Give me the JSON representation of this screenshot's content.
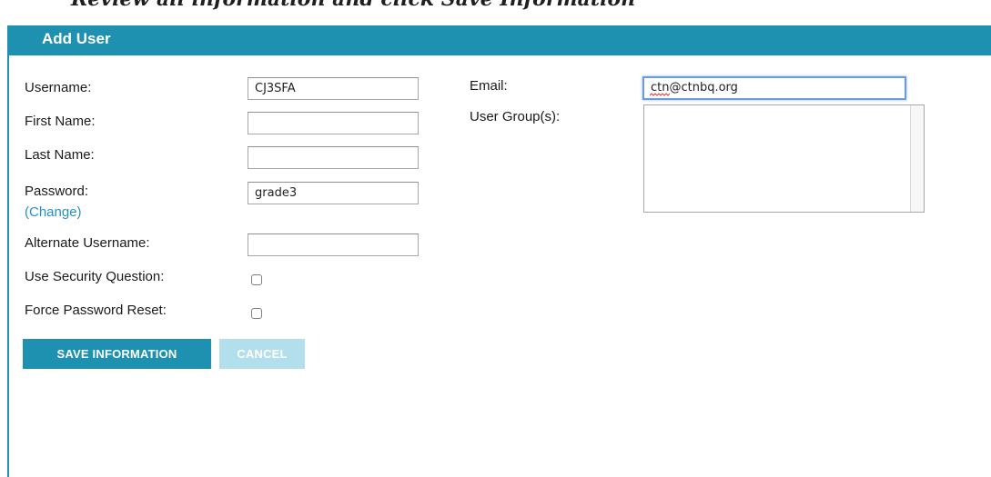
{
  "caption": "Review all information and click Save Information",
  "form": {
    "title": "Add User",
    "left_fields": [
      {
        "label": "Username:",
        "value": "CJ3SFA"
      },
      {
        "label": "First Name:",
        "value": ""
      },
      {
        "label": "Last Name:",
        "value": ""
      },
      {
        "label": "Password:",
        "value": "grade3",
        "link": "(Change)"
      },
      {
        "label": "Alternate Username:",
        "value": ""
      }
    ],
    "checkboxes": [
      {
        "label": "Use Security Question:",
        "checked": false
      },
      {
        "label": "Force Password Reset:",
        "checked": false
      }
    ],
    "email": {
      "label": "Email:",
      "value": "ctn@ctnbq.org"
    },
    "user_groups": {
      "label": "User Group(s):",
      "options": []
    },
    "buttons": {
      "save": "SAVE INFORMATION",
      "cancel": "CANCEL"
    }
  },
  "colors": {
    "header": "#1e90b0",
    "save_button": "#1e90b0",
    "cancel_button_disabled": "#b3dfec",
    "link": "#2590c8"
  }
}
